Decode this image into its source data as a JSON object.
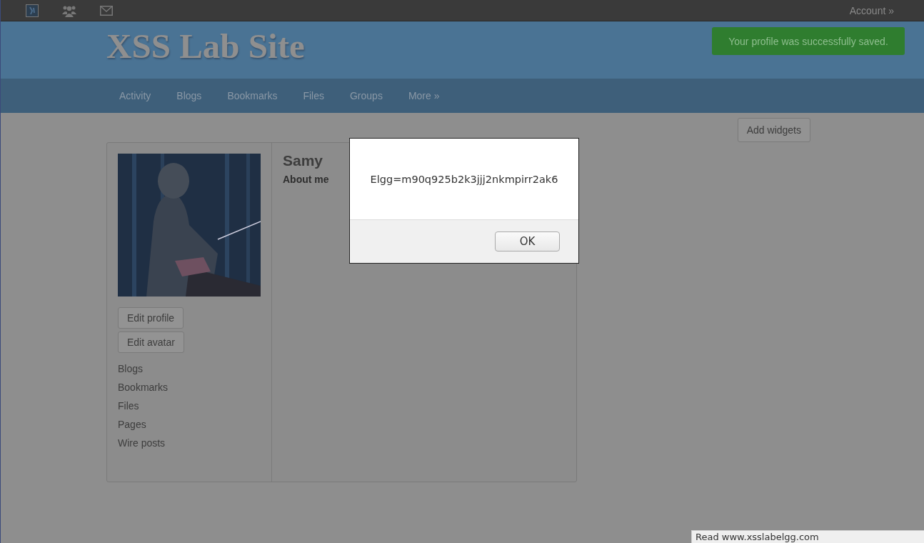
{
  "top_bar": {
    "account": "Account »"
  },
  "header": {
    "site_title": "XSS Lab Site",
    "message": "Your profile was successfully saved."
  },
  "nav": {
    "items": [
      {
        "label": "Activity"
      },
      {
        "label": "Blogs"
      },
      {
        "label": "Bookmarks"
      },
      {
        "label": "Files"
      },
      {
        "label": "Groups"
      },
      {
        "label": "More »"
      }
    ]
  },
  "widgets_button": "Add widgets",
  "profile": {
    "name": "Samy",
    "about_label": "About me",
    "buttons": [
      "Edit profile",
      "Edit avatar"
    ],
    "links": [
      "Blogs",
      "Bookmarks",
      "Files",
      "Pages",
      "Wire posts"
    ]
  },
  "dialog": {
    "message": "Elgg=m90q925b2k3jjj2nkmpirr2ak6",
    "button": "OK"
  },
  "status_bar": {
    "text": "Read www.xsslabelgg.com"
  }
}
